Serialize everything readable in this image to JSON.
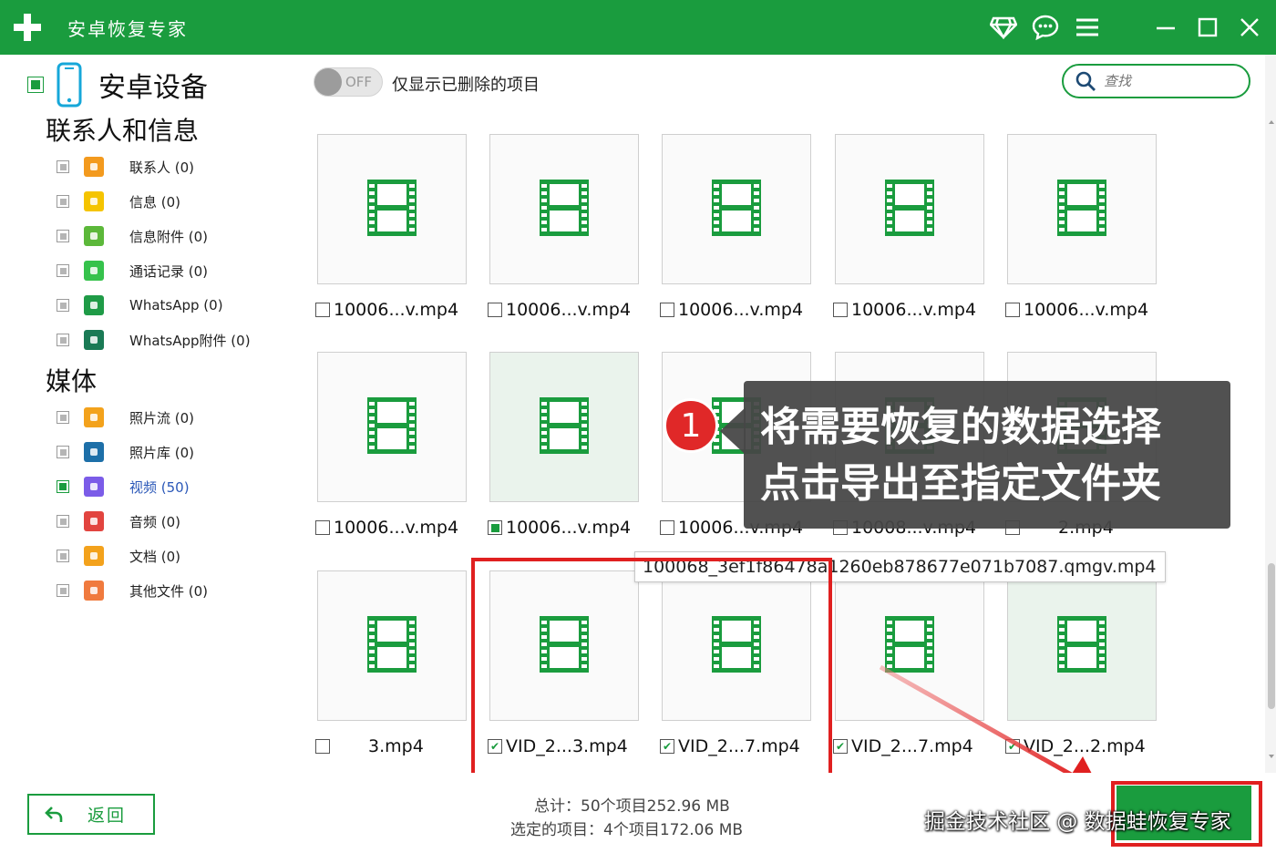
{
  "app": {
    "title": "安卓恢复专家"
  },
  "titlebar_icons": [
    "diamond-icon",
    "chat-icon",
    "menu-icon",
    "minimize-icon",
    "maximize-icon",
    "close-icon"
  ],
  "sidebar": {
    "device_label": "安卓设备",
    "contacts_section": "联系人和信息",
    "contacts_items": [
      {
        "label": "联系人 (0)",
        "icon": "contacts-icon",
        "color": "#f39a1e",
        "checked": false
      },
      {
        "label": "信息 (0)",
        "icon": "message-icon",
        "color": "#f5c400",
        "checked": false
      },
      {
        "label": "信息附件 (0)",
        "icon": "attachment-icon",
        "color": "#5cb83a",
        "checked": false
      },
      {
        "label": "通话记录 (0)",
        "icon": "phone-icon",
        "color": "#36c24c",
        "checked": false
      },
      {
        "label": "WhatsApp (0)",
        "icon": "whatsapp-icon",
        "color": "#1f9b47",
        "checked": false
      },
      {
        "label": "WhatsApp附件 (0)",
        "icon": "whatsapp-attachment-icon",
        "color": "#1a7a55",
        "checked": false
      }
    ],
    "media_section": "媒体",
    "media_items": [
      {
        "label": "照片流 (0)",
        "icon": "photo-stream-icon",
        "color": "#f3a21c",
        "checked": false
      },
      {
        "label": "照片库 (0)",
        "icon": "photo-library-icon",
        "color": "#1d6fa8",
        "checked": false
      },
      {
        "label": "视频 (50)",
        "icon": "video-icon",
        "color": "#7b5ce8",
        "checked": true
      },
      {
        "label": "音频 (0)",
        "icon": "audio-icon",
        "color": "#e2443f",
        "checked": false
      },
      {
        "label": "文档 (0)",
        "icon": "document-icon",
        "color": "#f3a21c",
        "checked": false
      },
      {
        "label": "其他文件 (0)",
        "icon": "other-files-icon",
        "color": "#f07a3e",
        "checked": false
      }
    ]
  },
  "toolbar": {
    "toggle_state": "OFF",
    "toggle_label": "仅显示已删除的项目",
    "search_placeholder": "查找"
  },
  "files": [
    {
      "name": "10006...v.mp4",
      "checked": false,
      "selected_tile": false
    },
    {
      "name": "10006...v.mp4",
      "checked": false,
      "selected_tile": false
    },
    {
      "name": "10006...v.mp4",
      "checked": false,
      "selected_tile": false
    },
    {
      "name": "10006...v.mp4",
      "checked": false,
      "selected_tile": false
    },
    {
      "name": "10006...v.mp4",
      "checked": false,
      "selected_tile": false
    },
    {
      "name": "10006...v.mp4",
      "checked": false,
      "selected_tile": false
    },
    {
      "name": "10006...v.mp4",
      "checked": "partial",
      "selected_tile": true
    },
    {
      "name": "10006...v.mp4",
      "checked": false,
      "selected_tile": false
    },
    {
      "name": "10008...v.mp4",
      "checked": false,
      "selected_tile": false
    },
    {
      "name": "2.mp4",
      "checked": false,
      "selected_tile": false
    },
    {
      "name": "3.mp4",
      "checked": false,
      "selected_tile": false
    },
    {
      "name": "VID_2...3.mp4",
      "checked": true,
      "selected_tile": false
    },
    {
      "name": "VID_2...7.mp4",
      "checked": true,
      "selected_tile": false
    },
    {
      "name": "VID_2...7.mp4",
      "checked": true,
      "selected_tile": false
    },
    {
      "name": "VID_2...2.mp4",
      "checked": true,
      "selected_tile": true
    }
  ],
  "tooltip_text": "100068_3ef1f86478a1260eb878677e071b7087.qmgv.mp4",
  "callout": {
    "number": "1",
    "line1": "将需要恢复的数据选择",
    "line2": "点击导出至指定文件夹"
  },
  "footer": {
    "back_label": "返回",
    "total_text": "总计：50个项目252.96 MB",
    "selected_text": "选定的项目：4个项目172.06 MB",
    "watermark": "掘金技术社区 @ 数据蛙恢复专家"
  },
  "colors": {
    "brand": "#1a9c3e",
    "highlight": "#e02020",
    "callout_bg": "#464646"
  }
}
